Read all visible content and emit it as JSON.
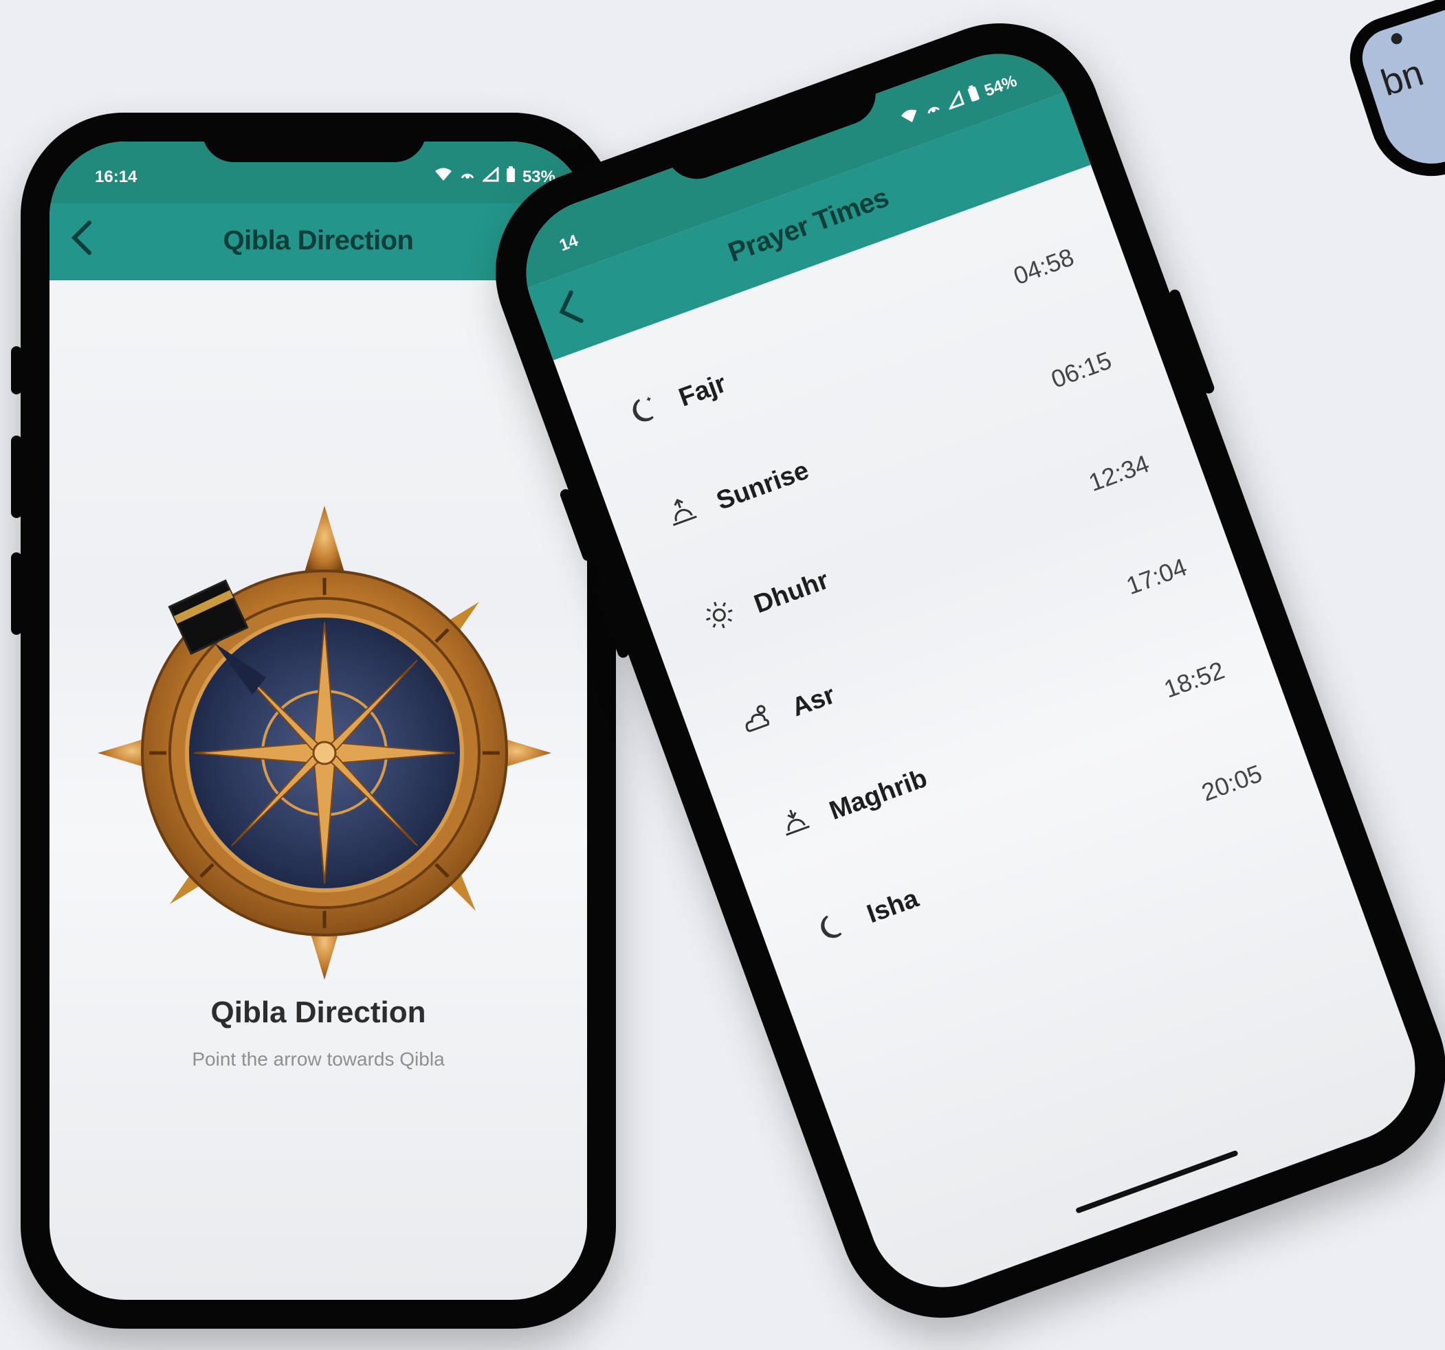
{
  "qibla_screen": {
    "status": {
      "time": "16:14",
      "battery": "53%"
    },
    "header": {
      "back_icon": "chevron-left-icon",
      "title": "Qibla Direction"
    },
    "compass_icon": "compass-icon",
    "kaaba_icon": "kaaba-icon",
    "title": "Qibla Direction",
    "subtitle": "Point the arrow towards Qibla"
  },
  "prayer_screen": {
    "status": {
      "time": "14",
      "battery": "54%"
    },
    "header": {
      "back_icon": "chevron-left-icon",
      "title": "Prayer Times"
    },
    "prayers": [
      {
        "name": "Fajr",
        "time": "04:58",
        "icon": "moon-star-icon"
      },
      {
        "name": "Sunrise",
        "time": "06:15",
        "icon": "sunrise-icon"
      },
      {
        "name": "Dhuhr",
        "time": "12:34",
        "icon": "sun-icon"
      },
      {
        "name": "Asr",
        "time": "17:04",
        "icon": "cloud-sun-icon"
      },
      {
        "name": "Maghrib",
        "time": "18:52",
        "icon": "sunset-icon"
      },
      {
        "name": "Isha",
        "time": "20:05",
        "icon": "moon-icon"
      }
    ]
  },
  "partial_bubble": {
    "text": "bn"
  },
  "colors": {
    "header": "#23958a",
    "statusbar": "#218a7c",
    "background": "#eceef3"
  }
}
